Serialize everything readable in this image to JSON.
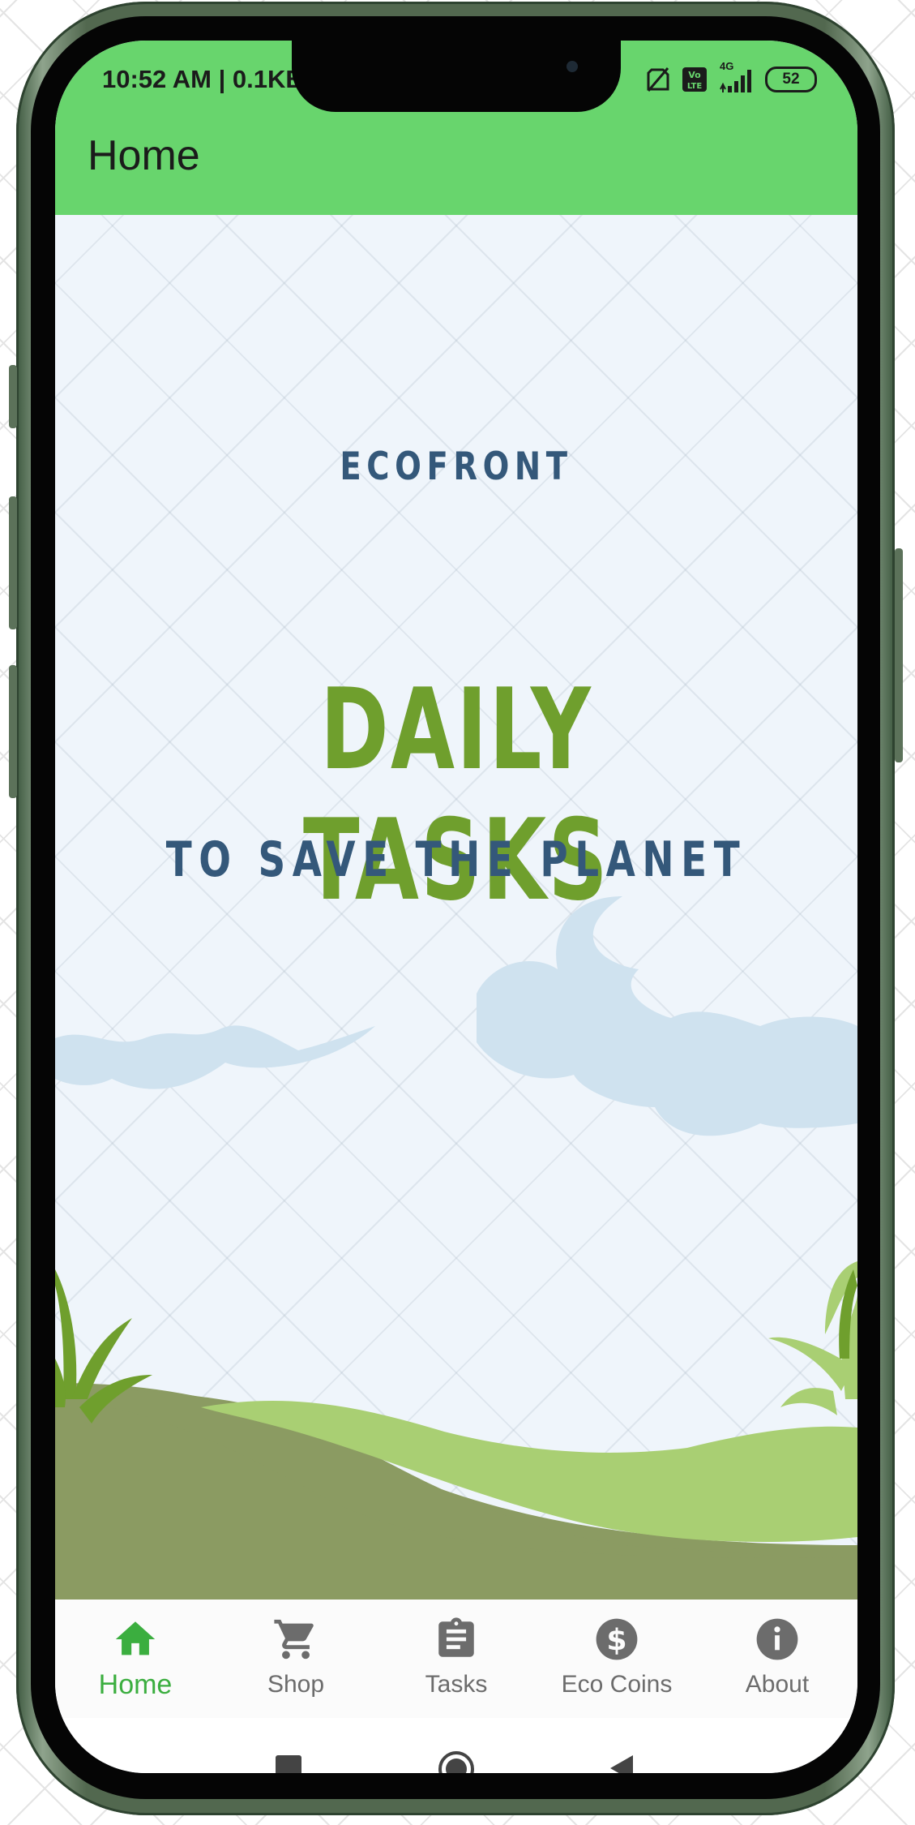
{
  "status_bar": {
    "time": "10:52 AM | 0.1KB/",
    "battery": "52",
    "network": "4G",
    "icons": [
      "no-sim-icon",
      "volte-icon",
      "signal-icon",
      "battery-icon"
    ]
  },
  "app_bar": {
    "title": "Home",
    "color": "#68d56d"
  },
  "hero": {
    "brand": "ECOFRONT",
    "headline": "DAILY TASKS",
    "subline": "TO SAVE THE PLANET",
    "colors": {
      "brand": "#34587a",
      "headline": "#6f9f2d",
      "sky": "#eff5fb",
      "clouds": "#cfe2ef"
    }
  },
  "bottom_nav": {
    "items": [
      {
        "label": "Home",
        "icon": "home-icon",
        "active": true
      },
      {
        "label": "Shop",
        "icon": "cart-icon",
        "active": false
      },
      {
        "label": "Tasks",
        "icon": "clipboard-icon",
        "active": false
      },
      {
        "label": "Eco Coins",
        "icon": "dollar-circle-icon",
        "active": false
      },
      {
        "label": "About",
        "icon": "info-icon",
        "active": false
      }
    ],
    "active_color": "#3bae3f",
    "inactive_color": "#6c6c6c"
  },
  "system_nav": {
    "buttons": [
      "recents-square-icon",
      "home-circle-icon",
      "back-triangle-icon"
    ]
  }
}
